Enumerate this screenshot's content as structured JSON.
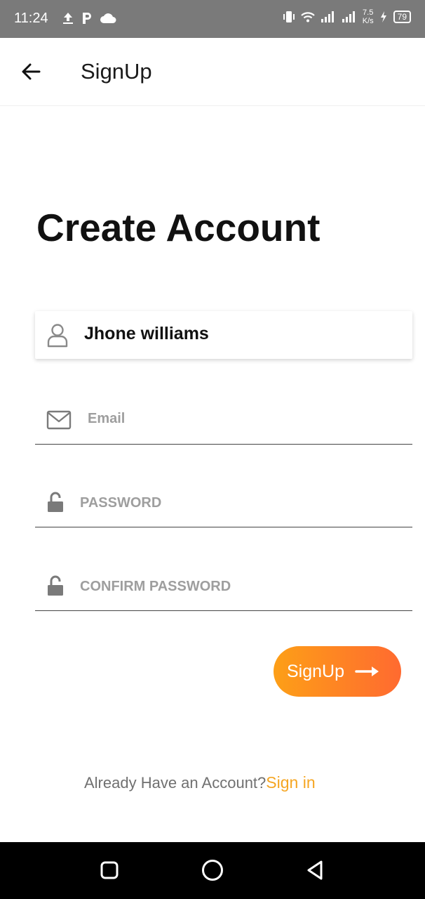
{
  "status_bar": {
    "time": "11:24",
    "net_speed_value": "7.5",
    "net_speed_unit": "K/s",
    "battery": "79",
    "icons": [
      "upload-icon",
      "p-icon",
      "cloud-icon",
      "vibrate-icon",
      "wifi-icon",
      "signal-icon",
      "signal-icon",
      "charging-icon"
    ]
  },
  "app_bar": {
    "title": "SignUp",
    "back_icon": "arrow-left-icon"
  },
  "main": {
    "heading": "Create Account",
    "name_field": {
      "value": "Jhone williams",
      "icon": "user-icon"
    },
    "email_field": {
      "placeholder": "Email",
      "icon": "mail-icon"
    },
    "password_field": {
      "placeholder": "PASSWORD",
      "icon": "lock-open-icon"
    },
    "confirm_password_field": {
      "placeholder": "CONFIRM PASSWORD",
      "icon": "lock-open-icon"
    },
    "signup_button": {
      "label": "SignUp",
      "icon": "arrow-right-icon"
    },
    "signin_prompt": {
      "text": "Already Have an Account?",
      "link": "Sign in"
    }
  },
  "colors": {
    "accent_start": "#fd9f17",
    "accent_end": "#ff6a30",
    "link": "#f5a623",
    "status_bar": "#7a7a7a"
  },
  "nav_bar": {
    "icons": [
      "square-icon",
      "circle-icon",
      "triangle-back-icon"
    ]
  }
}
